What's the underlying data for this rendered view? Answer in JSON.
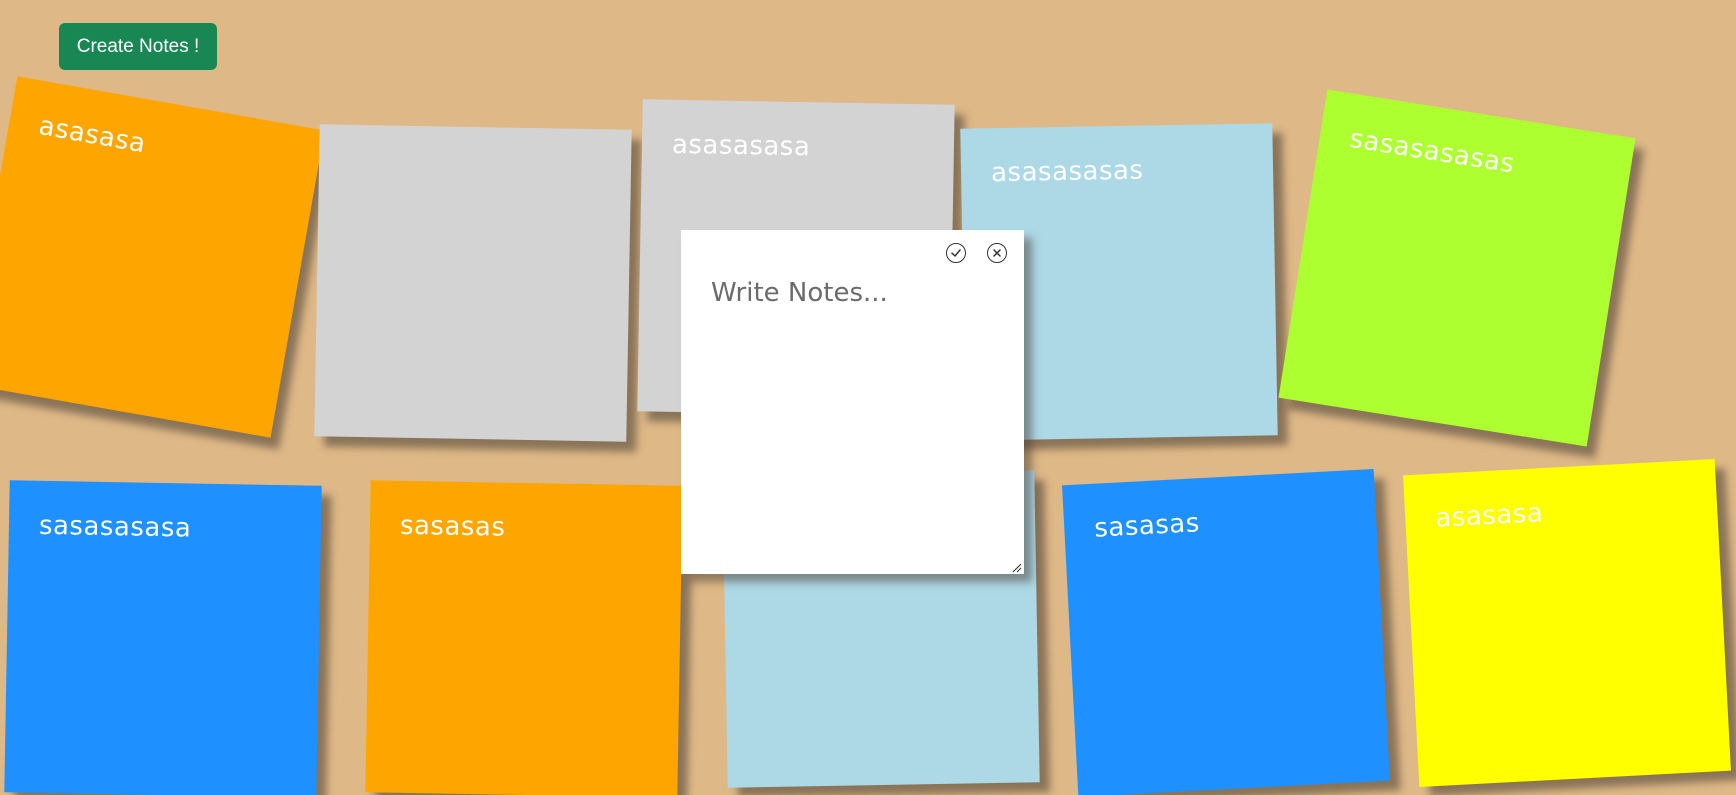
{
  "toolbar": {
    "create_label": "Create Notes !",
    "create_color": "#198754"
  },
  "board": {
    "background": "#deb887"
  },
  "notes": [
    {
      "text": "asasasa",
      "color": "#ffa500"
    },
    {
      "text": "",
      "color": "#d3d3d3"
    },
    {
      "text": "asasasasa",
      "color": "#d3d3d3"
    },
    {
      "text": "asasasasas",
      "color": "#add8e6"
    },
    {
      "text": "sasasasasas",
      "color": "#adff2f"
    },
    {
      "text": "sasasasasa",
      "color": "#1e90ff"
    },
    {
      "text": "sasasas",
      "color": "#ffa500"
    },
    {
      "text": "",
      "color": "#add8e6"
    },
    {
      "text": "sasasas",
      "color": "#1e90ff"
    },
    {
      "text": "asasasa",
      "color": "#ffff00"
    }
  ],
  "editor": {
    "placeholder": "Write Notes...",
    "value": "",
    "confirm_icon": "check-circle-icon",
    "close_icon": "x-circle-icon"
  }
}
